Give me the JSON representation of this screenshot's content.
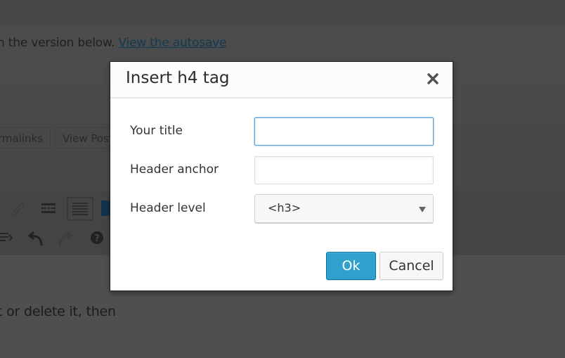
{
  "background": {
    "notice": {
      "text": "n the version below.",
      "link": "View the autosave"
    },
    "buttons": {
      "permalinks": "rmalinks",
      "view_post": "View Post"
    },
    "toolbar_icons": [
      "unlink-icon",
      "read-more-icon",
      "toolbar-toggle-icon",
      "plugin-icon",
      "paragraph-icon",
      "undo-icon",
      "redo-icon",
      "help-icon"
    ],
    "content_text": "t or delete it, then"
  },
  "modal": {
    "title": "Insert h4 tag",
    "close_icon": "close-icon",
    "fields": {
      "title": {
        "label": "Your title",
        "value": "",
        "placeholder": ""
      },
      "anchor": {
        "label": "Header anchor",
        "value": "",
        "placeholder": ""
      },
      "level": {
        "label": "Header level",
        "selected": "<h3>"
      }
    },
    "buttons": {
      "ok": "Ok",
      "cancel": "Cancel"
    }
  },
  "colors": {
    "primary_button": "#2ea2cc",
    "focus_border": "#5b9dd9",
    "overlay_bg": "#4a4a4a"
  }
}
